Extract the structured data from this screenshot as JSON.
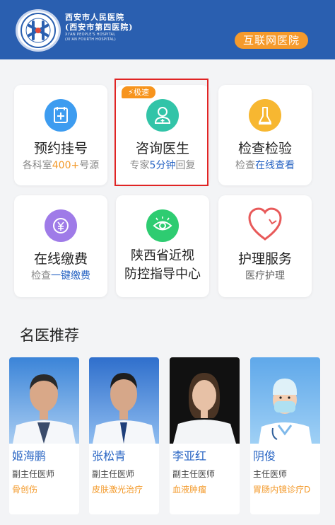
{
  "header": {
    "hospital_name_cn": "西安市人民医院",
    "hospital_alt_name_cn": "(西安市第四医院)",
    "hospital_name_en": "XI'AN PEOPLE'S HOSPITAL",
    "hospital_alt_name_en": "(XI'AN FOURTH HOSPITAL)",
    "internet_hospital_label": "互联网医院",
    "color": "#2a5fb0"
  },
  "services": [
    {
      "title": "预约挂号",
      "sub_pre": "各科室",
      "sub_hl": "400+",
      "sub_post": "号源",
      "icon": "appointment-icon",
      "color": "#3d9cf0"
    },
    {
      "title": "咨询医生",
      "sub_pre": "专家",
      "sub_hl": "5分钟",
      "sub_post": "回复",
      "icon": "doctor-icon",
      "color": "#32c4a8",
      "badge": "极速"
    },
    {
      "title": "检查检验",
      "sub_pre": "检查",
      "sub_hl": "在线查看",
      "sub_post": "",
      "icon": "lab-test-icon",
      "color": "#f7b731"
    },
    {
      "title": "在线缴费",
      "sub_pre": "检查",
      "sub_hl": "一键缴费",
      "sub_post": "",
      "icon": "payment-icon",
      "color": "#9f7be8"
    },
    {
      "title_line1": "陕西省近视",
      "title_line2": "防控指导中心",
      "icon": "eye-icon",
      "color": "#2ecc71"
    },
    {
      "title": "护理服务",
      "sub": "医疗护理",
      "icon": "heart-icon",
      "color": "#e85a5a"
    }
  ],
  "section": {
    "title": "名医推荐"
  },
  "doctors": [
    {
      "name": "姬海鹏",
      "title": "副主任医师",
      "specialty": "骨创伤"
    },
    {
      "name": "张松青",
      "title": "副主任医师",
      "specialty": "皮肤激光治疗"
    },
    {
      "name": "李亚红",
      "title": "副主任医师",
      "specialty": "血液肿瘤"
    },
    {
      "name": "阴俊",
      "title": "主任医师",
      "specialty": "胃肠内镜诊疗D"
    }
  ]
}
